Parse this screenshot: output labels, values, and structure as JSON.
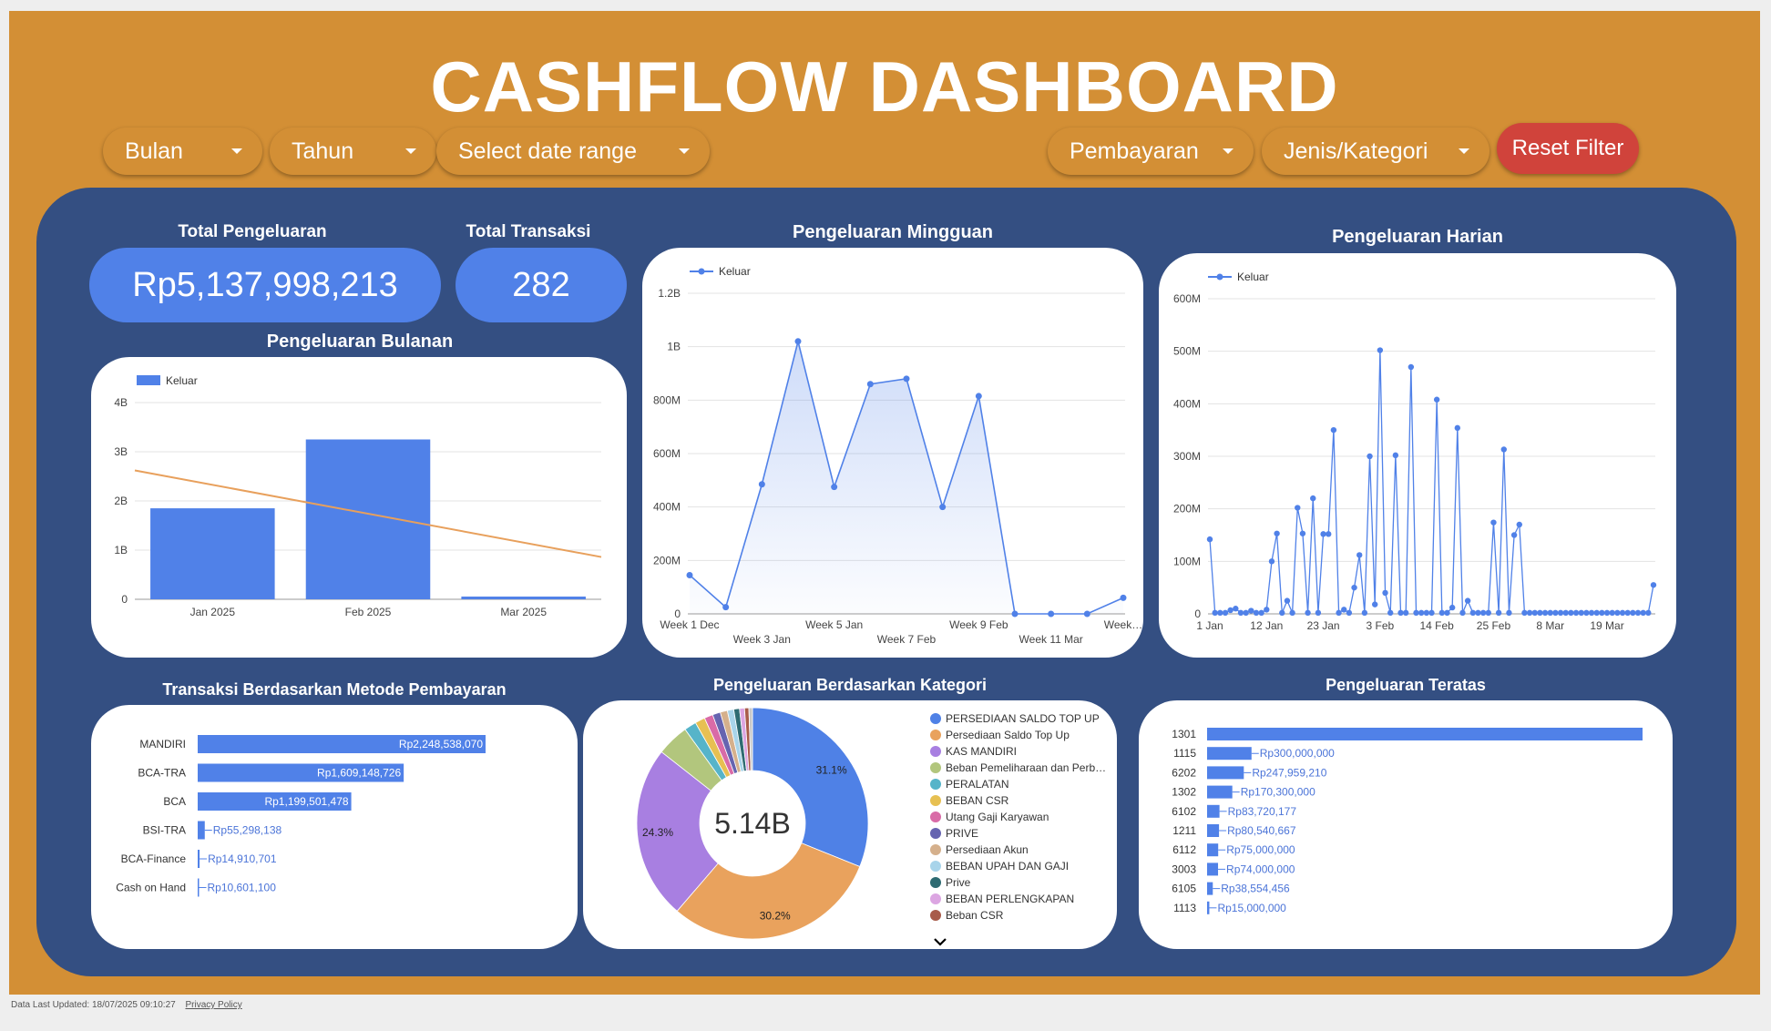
{
  "header": {
    "title": "CASHFLOW DASHBOARD"
  },
  "filters": {
    "bulan": "Bulan",
    "tahun": "Tahun",
    "date_range": "Select date range",
    "pembayaran": "Pembayaran",
    "kategori": "Jenis/Kategori",
    "reset": "Reset Filter"
  },
  "kpis": {
    "total_pengeluaran_label": "Total Pengeluaran",
    "total_pengeluaran_value": "Rp5,137,998,213",
    "total_transaksi_label": "Total Transaksi",
    "total_transaksi_value": "282"
  },
  "footer": {
    "updated": "Data Last Updated: 18/07/2025 09:10:27",
    "privacy": "Privacy Policy"
  },
  "chart_data": [
    {
      "id": "bulanan",
      "type": "bar",
      "title": "Pengeluaran Bulanan",
      "legend": "Keluar",
      "categories": [
        "Jan 2025",
        "Feb 2025",
        "Mar 2025"
      ],
      "values": [
        1850000000,
        3250000000,
        55000000
      ],
      "trendline": [
        2620000000,
        860000000
      ],
      "ylim": [
        0,
        4000000000
      ],
      "yticks": [
        "0",
        "1B",
        "2B",
        "3B",
        "4B"
      ],
      "colors": {
        "bar": "#5081e8",
        "trend": "#e8a05c"
      }
    },
    {
      "id": "mingguan",
      "type": "area",
      "title": "Pengeluaran Mingguan",
      "legend": "Keluar",
      "x_labels": [
        "Week 1 Dec",
        "Week 3 Jan",
        "Week 5 Jan",
        "Week 7 Feb",
        "Week 9 Feb",
        "Week 11 Mar",
        "Week…"
      ],
      "values": [
        145000000,
        25000000,
        485000000,
        1020000000,
        475000000,
        860000000,
        880000000,
        400000000,
        815000000,
        0,
        0,
        0,
        60000000
      ],
      "ylim": [
        0,
        1200000000
      ],
      "yticks": [
        "0",
        "200M",
        "400M",
        "600M",
        "800M",
        "1B",
        "1.2B"
      ],
      "colors": {
        "line": "#5081e8"
      }
    },
    {
      "id": "harian",
      "type": "line",
      "title": "Pengeluaran Harian",
      "legend": "Keluar",
      "x_labels": [
        "1 Jan",
        "12 Jan",
        "23 Jan",
        "3 Feb",
        "14 Feb",
        "25 Feb",
        "8 Mar",
        "19 Mar"
      ],
      "values": [
        142000000,
        2000000,
        2000000,
        2000000,
        7000000,
        10000000,
        2000000,
        2000000,
        6000000,
        2000000,
        2000000,
        8000000,
        100000000,
        153000000,
        2000000,
        25000000,
        2000000,
        202000000,
        153000000,
        2000000,
        220000000,
        2000000,
        152000000,
        152000000,
        350000000,
        2000000,
        8000000,
        2000000,
        50000000,
        112000000,
        2000000,
        300000000,
        18000000,
        502000000,
        40000000,
        2000000,
        302000000,
        2000000,
        2000000,
        470000000,
        2000000,
        2000000,
        2000000,
        2000000,
        408000000,
        2000000,
        2000000,
        12000000,
        354000000,
        2000000,
        25000000,
        2000000,
        2000000,
        2000000,
        2000000,
        174000000,
        2000000,
        313000000,
        2000000,
        150000000,
        170000000,
        2000000,
        2000000,
        2000000,
        2000000,
        2000000,
        2000000,
        2000000,
        2000000,
        2000000,
        2000000,
        2000000,
        2000000,
        2000000,
        2000000,
        2000000,
        2000000,
        2000000,
        2000000,
        2000000,
        2000000,
        2000000,
        2000000,
        2000000,
        2000000,
        2000000,
        55000000
      ],
      "ylim": [
        0,
        600000000
      ],
      "yticks": [
        "0",
        "100M",
        "200M",
        "300M",
        "400M",
        "500M",
        "600M"
      ],
      "colors": {
        "line": "#5081e8"
      }
    },
    {
      "id": "metode",
      "type": "bar",
      "orientation": "horizontal",
      "title": "Transaksi Berdasarkan Metode Pembayaran",
      "categories": [
        "MANDIRI",
        "BCA-TRA",
        "BCA",
        "BSI-TRA",
        "BCA-Finance",
        "Cash on Hand"
      ],
      "values": [
        2248538070,
        1609148726,
        1199501478,
        55298138,
        14910701,
        10601100
      ],
      "labels": [
        "Rp2,248,538,070",
        "Rp1,609,148,726",
        "Rp1,199,501,478",
        "Rp55,298,138",
        "Rp14,910,701",
        "Rp10,601,100"
      ],
      "colors": {
        "bar": "#5081e8"
      }
    },
    {
      "id": "kategori",
      "type": "pie",
      "title": "Pengeluaran Berdasarkan Kategori",
      "center_label": "5.14B",
      "legend": [
        "PERSEDIAAN SALDO TOP UP",
        "Persediaan Saldo Top Up",
        "KAS MANDIRI",
        "Beban Pemeliharaan dan Perb…",
        "PERALATAN",
        "BEBAN CSR",
        "Utang Gaji Karyawan",
        "PRIVE",
        "Persediaan Akun",
        "BEBAN UPAH DAN GAJI",
        "Prive",
        "BEBAN PERLENGKAPAN",
        "Beban CSR"
      ],
      "values": [
        31.1,
        30.2,
        24.3,
        4.5,
        1.7,
        1.4,
        1.2,
        1.1,
        1.0,
        0.9,
        0.8,
        0.7,
        0.6,
        0.5
      ],
      "slice_labels": [
        "31.1%",
        "30.2%",
        "24.3%"
      ],
      "colors": [
        "#4f81e6",
        "#e9a25d",
        "#a87fe1",
        "#b2c67d",
        "#56b4c9",
        "#e7c052",
        "#d96ba7",
        "#6664b0",
        "#d5b08c",
        "#a8d4ea",
        "#2e6b72",
        "#dca6e2",
        "#a85c4a",
        "#c9c9c9"
      ]
    },
    {
      "id": "teratas",
      "type": "bar",
      "orientation": "horizontal",
      "title": "Pengeluaran Teratas",
      "categories": [
        "1301",
        "1115",
        "6202",
        "1302",
        "6102",
        "1211",
        "6112",
        "3003",
        "6105",
        "1113"
      ],
      "values": [
        2940000000,
        300000000,
        247959210,
        170300000,
        83720177,
        80540667,
        75000000,
        74000000,
        38554456,
        15000000
      ],
      "labels": [
        "",
        "Rp300,000,000",
        "Rp247,959,210",
        "Rp170,300,000",
        "Rp83,720,177",
        "Rp80,540,667",
        "Rp75,000,000",
        "Rp74,000,000",
        "Rp38,554,456",
        "Rp15,000,000"
      ],
      "colors": {
        "bar": "#5081e8"
      }
    }
  ]
}
